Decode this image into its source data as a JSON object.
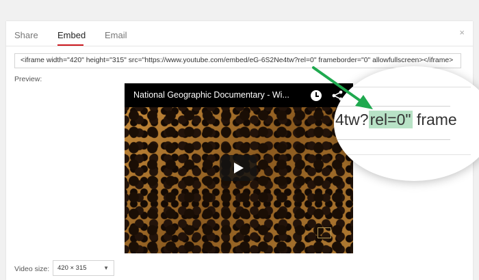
{
  "tabs": {
    "share": "Share",
    "embed": "Embed",
    "email": "Email",
    "active": "embed"
  },
  "close_label": "×",
  "embed_code": "<iframe width=\"420\" height=\"315\" src=\"https://www.youtube.com/embed/eG-6S2Ne4tw?rel=0\" frameborder=\"0\" allowfullscreen></iframe>",
  "preview_label": "Preview:",
  "video": {
    "title": "National Geographic Documentary - Wi...",
    "icons": [
      "clock-icon",
      "share-icon",
      "play-icon"
    ]
  },
  "video_size": {
    "label": "Video size:",
    "selected": "420 × 315",
    "caret": "▼"
  },
  "magnifier": {
    "before": "4tw?",
    "highlight": "rel=0\"",
    "after": " frame"
  },
  "colors": {
    "accent": "#cc181e",
    "arrow": "#1fa94f",
    "highlight": "#b8e2c6"
  }
}
